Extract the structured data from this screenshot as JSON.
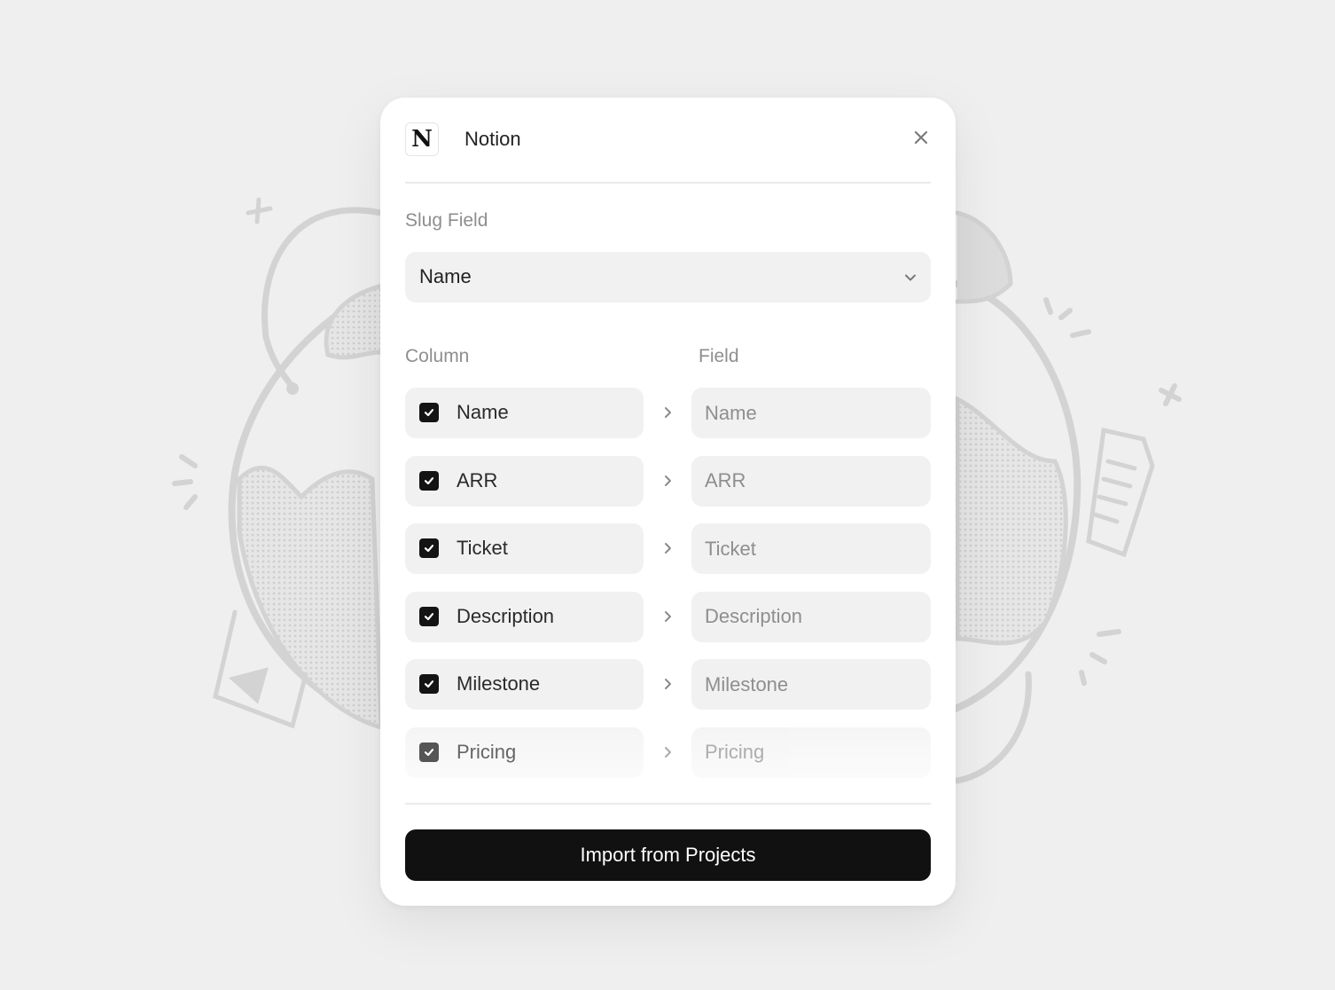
{
  "dialog": {
    "app_name": "Notion",
    "logo_letter": "N",
    "close_icon": "close-icon",
    "slug_field": {
      "label": "Slug Field",
      "selected": "Name",
      "icon": "chevron-down-icon"
    },
    "mapping": {
      "column_header": "Column",
      "field_header": "Field",
      "rows": [
        {
          "column": "Name",
          "checked": true,
          "field_placeholder": "Name"
        },
        {
          "column": "ARR",
          "checked": true,
          "field_placeholder": "ARR"
        },
        {
          "column": "Ticket",
          "checked": true,
          "field_placeholder": "Ticket"
        },
        {
          "column": "Description",
          "checked": true,
          "field_placeholder": "Description"
        },
        {
          "column": "Milestone",
          "checked": true,
          "field_placeholder": "Milestone"
        },
        {
          "column": "Pricing",
          "checked": true,
          "field_placeholder": "Pricing"
        }
      ]
    },
    "import_button": "Import from Projects"
  },
  "colors": {
    "background": "#efefef",
    "card": "#ffffff",
    "input_bg": "#f1f1f1",
    "primary_button": "#111111",
    "muted_text": "#8e8e8e"
  },
  "background_illustration": "globe-doodle"
}
